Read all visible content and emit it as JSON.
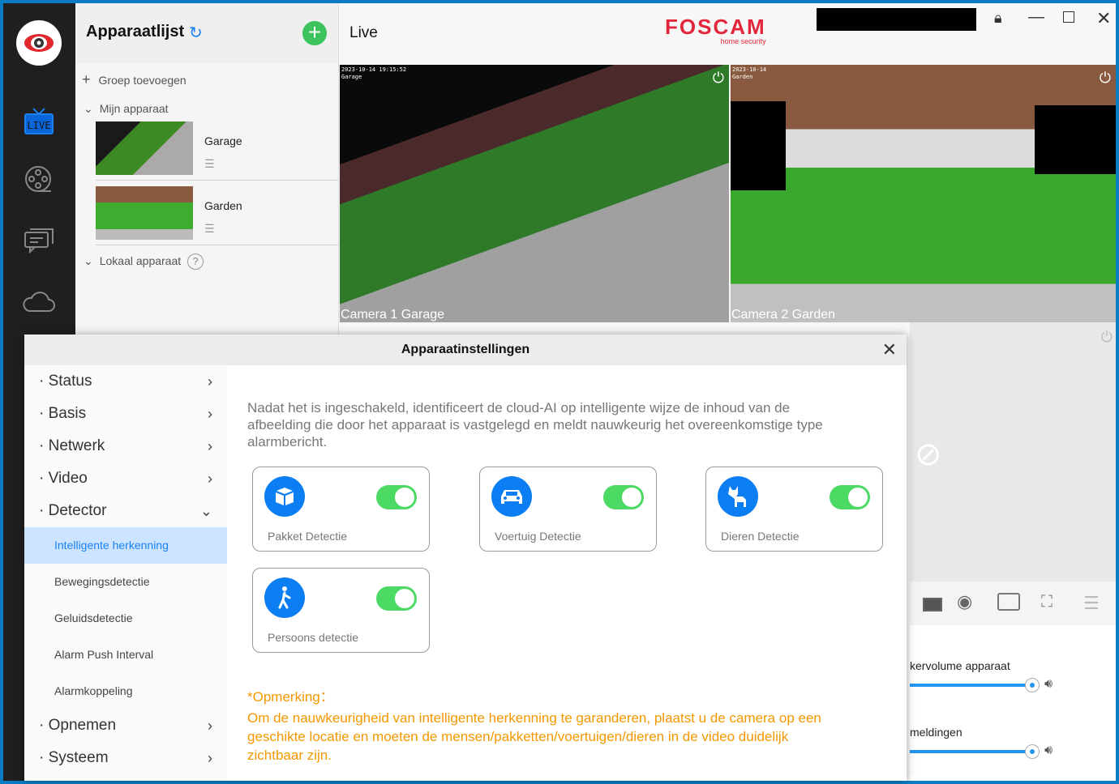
{
  "sidebar": {
    "icons": [
      "app-logo",
      "live-icon",
      "playback-reel-icon",
      "messages-icon",
      "cloud-icon"
    ],
    "live_label": "LIVE"
  },
  "device_panel": {
    "title": "Apparaatlijst",
    "add_group": "Groep toevoegen",
    "my_devices": "Mijn apparaat",
    "devices": [
      {
        "name": "Garage"
      },
      {
        "name": "Garden"
      }
    ],
    "local_devices": "Lokaal apparaat"
  },
  "header": {
    "title": "Live",
    "brand": "FOSCAM",
    "brand_sub": "home security"
  },
  "cameras": [
    {
      "label": "Camera 1 Garage",
      "osd_time": "2023-10-14 19:15:52",
      "osd_name": "Garage"
    },
    {
      "label": "Camera 2 Garden",
      "osd_time": "2023-10-14",
      "osd_name": "Garden"
    }
  ],
  "modal": {
    "title": "Apparaatinstellingen",
    "menu": [
      {
        "label": "Status"
      },
      {
        "label": "Basis"
      },
      {
        "label": "Netwerk"
      },
      {
        "label": "Video"
      },
      {
        "label": "Detector"
      }
    ],
    "submenu": [
      "Intelligente herkenning",
      "Bewegingsdetectie",
      "Geluidsdetectie",
      "Alarm Push Interval",
      "Alarmkoppeling"
    ],
    "menu_after": [
      {
        "label": "Opnemen"
      },
      {
        "label": "Systeem"
      }
    ],
    "description": "Nadat het is ingeschakeld, identificeert de cloud-AI op intelligente wijze de inhoud van de afbeelding die door het apparaat is vastgelegd en meldt nauwkeurig het overeenkomstige type alarmbericht.",
    "cards": [
      {
        "label": "Pakket Detectie",
        "icon": "package-icon",
        "enabled": true
      },
      {
        "label": "Voertuig Detectie",
        "icon": "car-icon",
        "enabled": true
      },
      {
        "label": "Dieren Detectie",
        "icon": "cat-icon",
        "enabled": true
      },
      {
        "label": "Persoons detectie",
        "icon": "person-walking-icon",
        "enabled": true
      }
    ],
    "note_title": "*Opmerking：",
    "note_text": "Om de nauwkeurigheid van intelligente herkenning te garanderen, plaatst u de camera op een geschikte locatie en moeten de mensen/pakketten/voertuigen/dieren in de video duidelijk zichtbaar zijn."
  },
  "right_panel": {
    "speaker_volume_label": "kervolume apparaat",
    "notifications_label": "meldingen",
    "speaker_volume": 100,
    "notifications_volume": 100
  },
  "colors": {
    "accent": "#0a7ef2",
    "toggle_on": "#4cd964",
    "note": "#f39800",
    "window_border": "#0a7cc4"
  }
}
